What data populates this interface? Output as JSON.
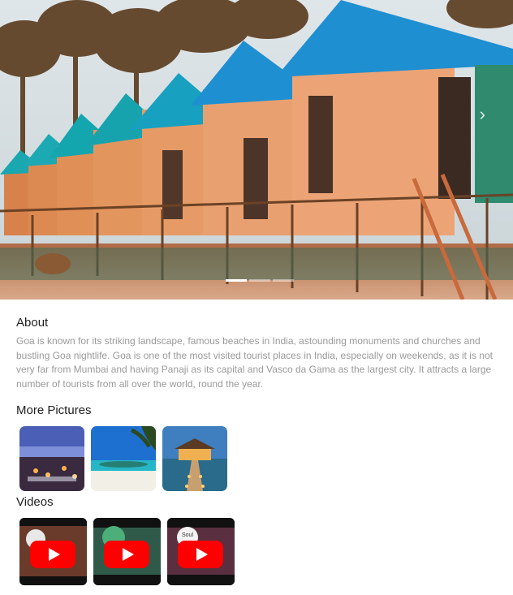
{
  "carousel": {
    "slides": [
      "slide-1",
      "slide-2",
      "slide-3"
    ],
    "active_slide": 1,
    "prev_icon": "chevron-left-icon",
    "next_icon": "chevron-right-icon",
    "next_glyph": "›"
  },
  "about": {
    "title": "About",
    "text": "Goa is known for its striking landscape, famous beaches in India, astounding monuments and churches and bustling Goa nightlife. Goa is one of the most visited tourist places in India, especially on weekends, as it is not very far from Mumbai and having Panaji as its capital and Vasco da Gama as the largest city. It attracts a large number of tourists from all over the world, round the year."
  },
  "pictures": {
    "title": "More Pictures",
    "items": [
      "beach-dinner",
      "tropical-beach",
      "water-villa"
    ]
  },
  "videos": {
    "title": "Videos",
    "items": [
      {
        "channel_badge": ""
      },
      {
        "channel_badge": ""
      },
      {
        "channel_badge": "Soul"
      }
    ],
    "play_icon": "youtube-play-icon"
  },
  "colors": {
    "text_dark": "#222222",
    "text_muted": "#9a9a9a",
    "youtube_red": "#ff0000",
    "roof_blue": "#1e8fd0"
  }
}
